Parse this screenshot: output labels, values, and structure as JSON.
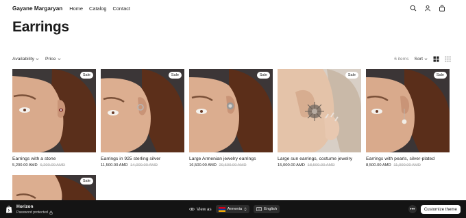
{
  "header": {
    "brand": "Gayane Margaryan",
    "nav": [
      "Home",
      "Catalog",
      "Contact"
    ],
    "icons": [
      "search-icon",
      "account-icon",
      "cart-icon"
    ]
  },
  "page": {
    "title": "Earrings"
  },
  "filters": {
    "availability": "Availability",
    "price": "Price",
    "count": "6 items",
    "sort": "Sort"
  },
  "products": [
    {
      "name": "Earrings with a stone",
      "price": "5,200.00 AMD",
      "was": "6,200.00 AMD",
      "badge": "Sale"
    },
    {
      "name": "Earrings in 925 sterling silver",
      "price": "11,500.00 AMD",
      "was": "14,000.00 AMD",
      "badge": "Sale"
    },
    {
      "name": "Large Armenian jewelry earrings",
      "price": "16,500.00 AMD",
      "was": "20,500.00 AMD",
      "badge": "Sale"
    },
    {
      "name": "Large sun earrings, costume jewelry",
      "price": "15,000.00 AMD",
      "was": "18,500.00 AMD",
      "badge": "Sale"
    },
    {
      "name": "Earrings with pearls, silver-plated",
      "price": "8,500.00 AMD",
      "was": "11,000.00 AMD",
      "badge": "Sale"
    },
    {
      "name": "",
      "price": "",
      "was": "",
      "badge": "Sale"
    }
  ],
  "bottom_bar": {
    "theme": "Horizon",
    "password": "Password protected",
    "view_as": "View as",
    "country": "Armenia",
    "language": "English",
    "more": "•••",
    "customize": "Customize theme"
  },
  "colors": {
    "bar_bg": "#141414",
    "accent": "#1a1a1a"
  }
}
